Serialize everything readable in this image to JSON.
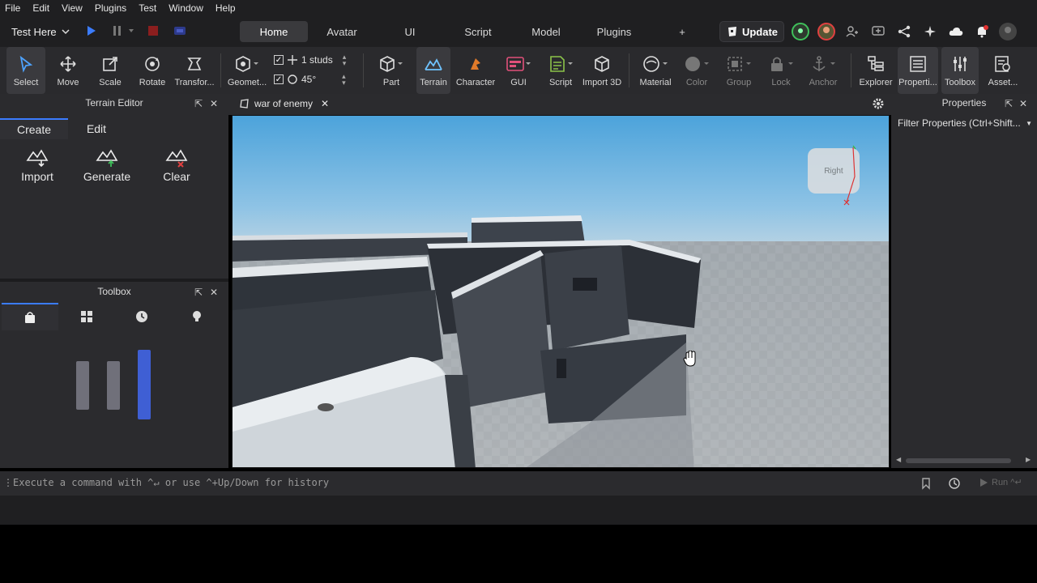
{
  "menu": [
    "File",
    "Edit",
    "View",
    "Plugins",
    "Test",
    "Window",
    "Help"
  ],
  "test_mode": "Test Here",
  "ribbon_tabs": [
    "Home",
    "Avatar",
    "UI",
    "Script",
    "Model",
    "Plugins",
    "+"
  ],
  "update_label": "Update",
  "tools": {
    "select": "Select",
    "move": "Move",
    "scale": "Scale",
    "rotate": "Rotate",
    "transform": "Transfor...",
    "geometry": "Geomet...",
    "part": "Part",
    "terrain": "Terrain",
    "character": "Character",
    "gui": "GUI",
    "script": "Script",
    "import3d": "Import 3D",
    "material": "Material",
    "color": "Color",
    "group": "Group",
    "lock": "Lock",
    "anchor": "Anchor",
    "explorer": "Explorer",
    "properties": "Properti...",
    "toolbox": "Toolbox",
    "assets": "Asset..."
  },
  "snap": {
    "studs": "1 studs",
    "angle": "45°"
  },
  "terrain_editor": {
    "title": "Terrain Editor",
    "tabs": [
      "Create",
      "Edit"
    ],
    "tools": [
      "Import",
      "Generate",
      "Clear"
    ]
  },
  "toolbox": {
    "title": "Toolbox"
  },
  "document_tab": "war of enemy",
  "viewcube_label": "Right",
  "properties": {
    "title": "Properties",
    "filter": "Filter Properties (Ctrl+Shift..."
  },
  "command": {
    "placeholder": "Execute a command with ^↵ or use ^+Up/Down for history",
    "run": "Run ^↵"
  },
  "colors": {
    "accent": "#3b7cff",
    "bg": "#2b2b2e",
    "record": "#c0392b"
  }
}
